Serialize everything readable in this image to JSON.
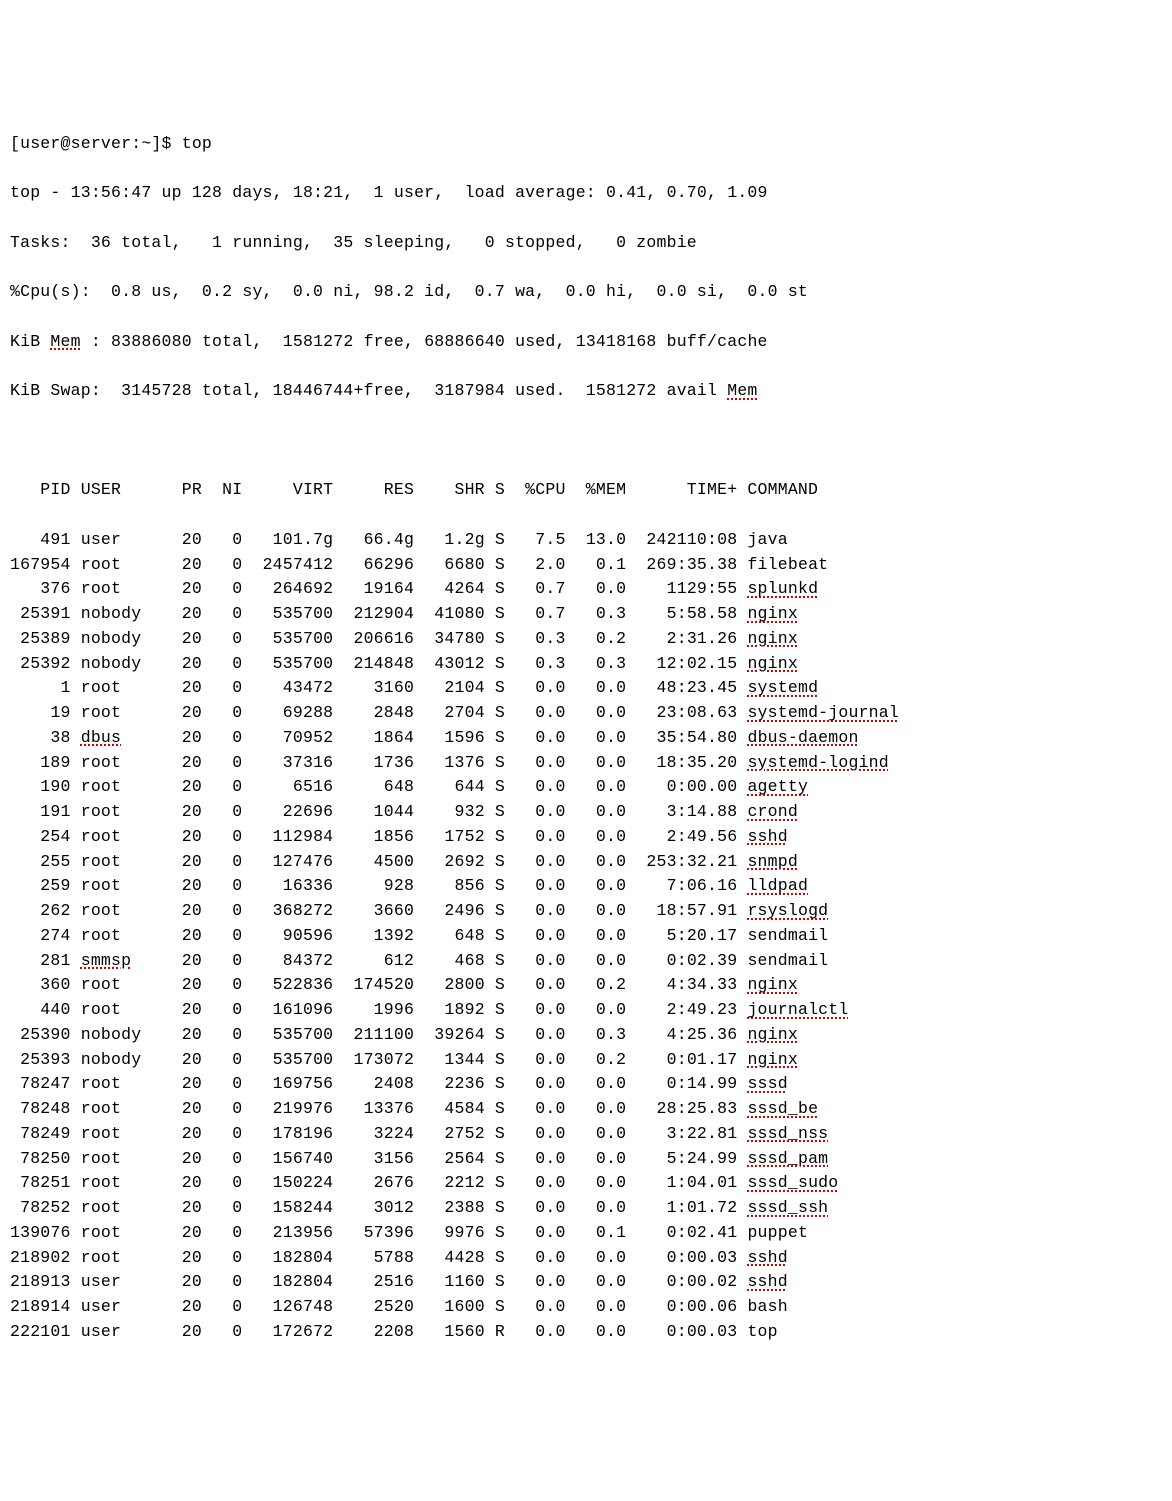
{
  "prompt": "[user@server:~]$ top",
  "header": {
    "line1": "top - 13:56:47 up 128 days, 18:21,  1 user,  load average: 0.41, 0.70, 1.09",
    "line2": "Tasks:  36 total,   1 running,  35 sleeping,   0 stopped,   0 zombie",
    "line3": "%Cpu(s):  0.8 us,  0.2 sy,  0.0 ni, 98.2 id,  0.7 wa,  0.0 hi,  0.0 si,  0.0 st",
    "line4a": "KiB ",
    "line4mem": "Mem",
    "line4b": " : 83886080 total,  1581272 free, 68886640 used, 13418168 buff/cache",
    "line5a": "KiB Swap:  3145728 total, 18446744+free,  3187984 used.  1581272 avail ",
    "line5mem": "Mem"
  },
  "columns": [
    "PID",
    "USER",
    "PR",
    "NI",
    "VIRT",
    "RES",
    "SHR",
    "S",
    "%CPU",
    "%MEM",
    "TIME+",
    "COMMAND"
  ],
  "processes": [
    {
      "pid": "491",
      "user": "user",
      "pr": "20",
      "ni": "0",
      "virt": "101.7g",
      "res": "66.4g",
      "shr": "1.2g",
      "s": "S",
      "cpu": "7.5",
      "mem": "13.0",
      "time": "242110:08",
      "cmd": "java",
      "spell": false
    },
    {
      "pid": "167954",
      "user": "root",
      "pr": "20",
      "ni": "0",
      "virt": "2457412",
      "res": "66296",
      "shr": "6680",
      "s": "S",
      "cpu": "2.0",
      "mem": "0.1",
      "time": "269:35.38",
      "cmd": "filebeat",
      "spell": false
    },
    {
      "pid": "376",
      "user": "root",
      "pr": "20",
      "ni": "0",
      "virt": "264692",
      "res": "19164",
      "shr": "4264",
      "s": "S",
      "cpu": "0.7",
      "mem": "0.0",
      "time": "1129:55",
      "cmd": "splunkd",
      "spell": true
    },
    {
      "pid": "25391",
      "user": "nobody",
      "pr": "20",
      "ni": "0",
      "virt": "535700",
      "res": "212904",
      "shr": "41080",
      "s": "S",
      "cpu": "0.7",
      "mem": "0.3",
      "time": "5:58.58",
      "cmd": "nginx",
      "spell": true
    },
    {
      "pid": "25389",
      "user": "nobody",
      "pr": "20",
      "ni": "0",
      "virt": "535700",
      "res": "206616",
      "shr": "34780",
      "s": "S",
      "cpu": "0.3",
      "mem": "0.2",
      "time": "2:31.26",
      "cmd": "nginx",
      "spell": true
    },
    {
      "pid": "25392",
      "user": "nobody",
      "pr": "20",
      "ni": "0",
      "virt": "535700",
      "res": "214848",
      "shr": "43012",
      "s": "S",
      "cpu": "0.3",
      "mem": "0.3",
      "time": "12:02.15",
      "cmd": "nginx",
      "spell": true
    },
    {
      "pid": "1",
      "user": "root",
      "pr": "20",
      "ni": "0",
      "virt": "43472",
      "res": "3160",
      "shr": "2104",
      "s": "S",
      "cpu": "0.0",
      "mem": "0.0",
      "time": "48:23.45",
      "cmd": "systemd",
      "spell": true
    },
    {
      "pid": "19",
      "user": "root",
      "pr": "20",
      "ni": "0",
      "virt": "69288",
      "res": "2848",
      "shr": "2704",
      "s": "S",
      "cpu": "0.0",
      "mem": "0.0",
      "time": "23:08.63",
      "cmd": "systemd-journal",
      "spell": true
    },
    {
      "pid": "38",
      "user": "dbus",
      "userSpell": true,
      "pr": "20",
      "ni": "0",
      "virt": "70952",
      "res": "1864",
      "shr": "1596",
      "s": "S",
      "cpu": "0.0",
      "mem": "0.0",
      "time": "35:54.80",
      "cmd": "dbus-daemon",
      "spell": true
    },
    {
      "pid": "189",
      "user": "root",
      "pr": "20",
      "ni": "0",
      "virt": "37316",
      "res": "1736",
      "shr": "1376",
      "s": "S",
      "cpu": "0.0",
      "mem": "0.0",
      "time": "18:35.20",
      "cmd": "systemd-logind",
      "spell": true
    },
    {
      "pid": "190",
      "user": "root",
      "pr": "20",
      "ni": "0",
      "virt": "6516",
      "res": "648",
      "shr": "644",
      "s": "S",
      "cpu": "0.0",
      "mem": "0.0",
      "time": "0:00.00",
      "cmd": "agetty",
      "spell": true
    },
    {
      "pid": "191",
      "user": "root",
      "pr": "20",
      "ni": "0",
      "virt": "22696",
      "res": "1044",
      "shr": "932",
      "s": "S",
      "cpu": "0.0",
      "mem": "0.0",
      "time": "3:14.88",
      "cmd": "crond",
      "spell": true
    },
    {
      "pid": "254",
      "user": "root",
      "pr": "20",
      "ni": "0",
      "virt": "112984",
      "res": "1856",
      "shr": "1752",
      "s": "S",
      "cpu": "0.0",
      "mem": "0.0",
      "time": "2:49.56",
      "cmd": "sshd",
      "spell": true
    },
    {
      "pid": "255",
      "user": "root",
      "pr": "20",
      "ni": "0",
      "virt": "127476",
      "res": "4500",
      "shr": "2692",
      "s": "S",
      "cpu": "0.0",
      "mem": "0.0",
      "time": "253:32.21",
      "cmd": "snmpd",
      "spell": true
    },
    {
      "pid": "259",
      "user": "root",
      "pr": "20",
      "ni": "0",
      "virt": "16336",
      "res": "928",
      "shr": "856",
      "s": "S",
      "cpu": "0.0",
      "mem": "0.0",
      "time": "7:06.16",
      "cmd": "lldpad",
      "spell": true
    },
    {
      "pid": "262",
      "user": "root",
      "pr": "20",
      "ni": "0",
      "virt": "368272",
      "res": "3660",
      "shr": "2496",
      "s": "S",
      "cpu": "0.0",
      "mem": "0.0",
      "time": "18:57.91",
      "cmd": "rsyslogd",
      "spell": true
    },
    {
      "pid": "274",
      "user": "root",
      "pr": "20",
      "ni": "0",
      "virt": "90596",
      "res": "1392",
      "shr": "648",
      "s": "S",
      "cpu": "0.0",
      "mem": "0.0",
      "time": "5:20.17",
      "cmd": "sendmail",
      "spell": false
    },
    {
      "pid": "281",
      "user": "smmsp",
      "userSpell": true,
      "pr": "20",
      "ni": "0",
      "virt": "84372",
      "res": "612",
      "shr": "468",
      "s": "S",
      "cpu": "0.0",
      "mem": "0.0",
      "time": "0:02.39",
      "cmd": "sendmail",
      "spell": false
    },
    {
      "pid": "360",
      "user": "root",
      "pr": "20",
      "ni": "0",
      "virt": "522836",
      "res": "174520",
      "shr": "2800",
      "s": "S",
      "cpu": "0.0",
      "mem": "0.2",
      "time": "4:34.33",
      "cmd": "nginx",
      "spell": true
    },
    {
      "pid": "440",
      "user": "root",
      "pr": "20",
      "ni": "0",
      "virt": "161096",
      "res": "1996",
      "shr": "1892",
      "s": "S",
      "cpu": "0.0",
      "mem": "0.0",
      "time": "2:49.23",
      "cmd": "journalctl",
      "spell": true
    },
    {
      "pid": "25390",
      "user": "nobody",
      "pr": "20",
      "ni": "0",
      "virt": "535700",
      "res": "211100",
      "shr": "39264",
      "s": "S",
      "cpu": "0.0",
      "mem": "0.3",
      "time": "4:25.36",
      "cmd": "nginx",
      "spell": true
    },
    {
      "pid": "25393",
      "user": "nobody",
      "pr": "20",
      "ni": "0",
      "virt": "535700",
      "res": "173072",
      "shr": "1344",
      "s": "S",
      "cpu": "0.0",
      "mem": "0.2",
      "time": "0:01.17",
      "cmd": "nginx",
      "spell": true
    },
    {
      "pid": "78247",
      "user": "root",
      "pr": "20",
      "ni": "0",
      "virt": "169756",
      "res": "2408",
      "shr": "2236",
      "s": "S",
      "cpu": "0.0",
      "mem": "0.0",
      "time": "0:14.99",
      "cmd": "sssd",
      "spell": true
    },
    {
      "pid": "78248",
      "user": "root",
      "pr": "20",
      "ni": "0",
      "virt": "219976",
      "res": "13376",
      "shr": "4584",
      "s": "S",
      "cpu": "0.0",
      "mem": "0.0",
      "time": "28:25.83",
      "cmd": "sssd_be",
      "spell": true
    },
    {
      "pid": "78249",
      "user": "root",
      "pr": "20",
      "ni": "0",
      "virt": "178196",
      "res": "3224",
      "shr": "2752",
      "s": "S",
      "cpu": "0.0",
      "mem": "0.0",
      "time": "3:22.81",
      "cmd": "sssd_nss",
      "spell": true
    },
    {
      "pid": "78250",
      "user": "root",
      "pr": "20",
      "ni": "0",
      "virt": "156740",
      "res": "3156",
      "shr": "2564",
      "s": "S",
      "cpu": "0.0",
      "mem": "0.0",
      "time": "5:24.99",
      "cmd": "sssd_pam",
      "spell": true
    },
    {
      "pid": "78251",
      "user": "root",
      "pr": "20",
      "ni": "0",
      "virt": "150224",
      "res": "2676",
      "shr": "2212",
      "s": "S",
      "cpu": "0.0",
      "mem": "0.0",
      "time": "1:04.01",
      "cmd": "sssd_sudo",
      "spell": true
    },
    {
      "pid": "78252",
      "user": "root",
      "pr": "20",
      "ni": "0",
      "virt": "158244",
      "res": "3012",
      "shr": "2388",
      "s": "S",
      "cpu": "0.0",
      "mem": "0.0",
      "time": "1:01.72",
      "cmd": "sssd_ssh",
      "spell": true
    },
    {
      "pid": "139076",
      "user": "root",
      "pr": "20",
      "ni": "0",
      "virt": "213956",
      "res": "57396",
      "shr": "9976",
      "s": "S",
      "cpu": "0.0",
      "mem": "0.1",
      "time": "0:02.41",
      "cmd": "puppet",
      "spell": false
    },
    {
      "pid": "218902",
      "user": "root",
      "pr": "20",
      "ni": "0",
      "virt": "182804",
      "res": "5788",
      "shr": "4428",
      "s": "S",
      "cpu": "0.0",
      "mem": "0.0",
      "time": "0:00.03",
      "cmd": "sshd",
      "spell": true
    },
    {
      "pid": "218913",
      "user": "user",
      "pr": "20",
      "ni": "0",
      "virt": "182804",
      "res": "2516",
      "shr": "1160",
      "s": "S",
      "cpu": "0.0",
      "mem": "0.0",
      "time": "0:00.02",
      "cmd": "sshd",
      "spell": true
    },
    {
      "pid": "218914",
      "user": "user",
      "pr": "20",
      "ni": "0",
      "virt": "126748",
      "res": "2520",
      "shr": "1600",
      "s": "S",
      "cpu": "0.0",
      "mem": "0.0",
      "time": "0:00.06",
      "cmd": "bash",
      "spell": false
    },
    {
      "pid": "222101",
      "user": "user",
      "pr": "20",
      "ni": "0",
      "virt": "172672",
      "res": "2208",
      "shr": "1560",
      "s": "R",
      "cpu": "0.0",
      "mem": "0.0",
      "time": "0:00.03",
      "cmd": "top",
      "spell": false
    }
  ]
}
